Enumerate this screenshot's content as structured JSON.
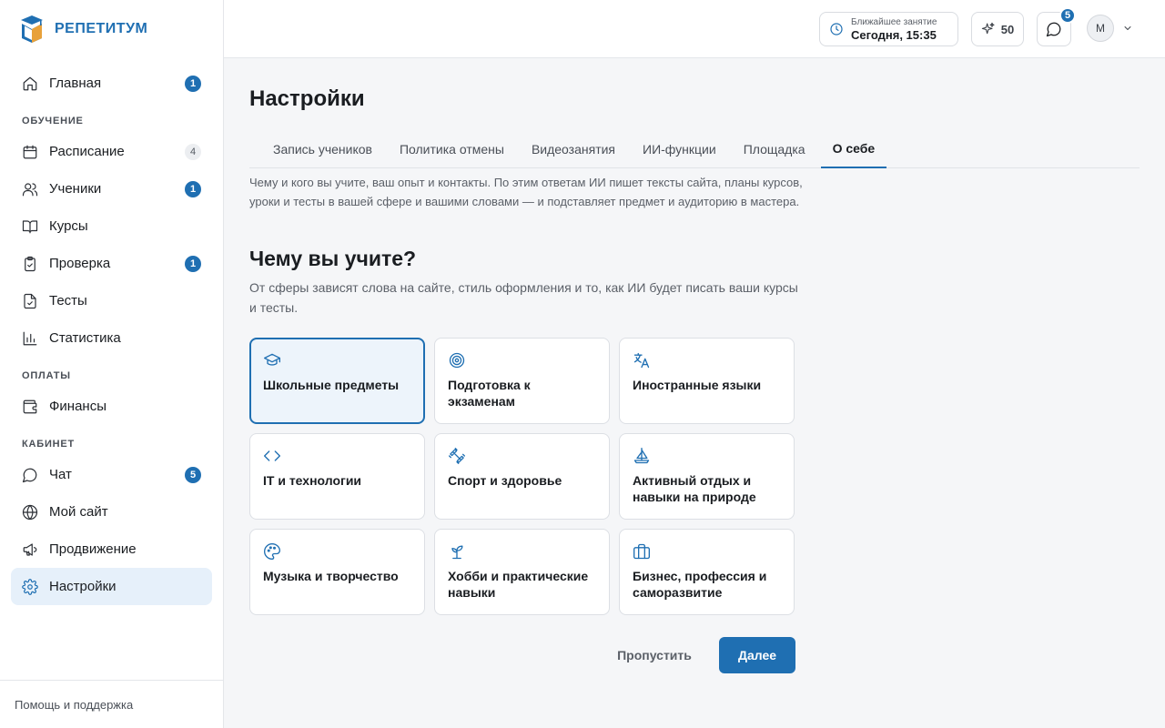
{
  "app": {
    "logo_text": "РЕПЕТИТУМ",
    "accent_color": "#1f6fb2"
  },
  "sidebar": {
    "items": [
      {
        "label": "Главная",
        "icon": "home-icon",
        "badge": "1"
      },
      {
        "section": "ОБУЧЕНИЕ"
      },
      {
        "label": "Расписание",
        "icon": "calendar-icon",
        "badge": "4",
        "badge_style": "muted"
      },
      {
        "label": "Ученики",
        "icon": "users-icon",
        "badge": "1"
      },
      {
        "label": "Курсы",
        "icon": "book-icon"
      },
      {
        "label": "Проверка",
        "icon": "clipboard-check-icon",
        "badge": "1"
      },
      {
        "label": "Тесты",
        "icon": "file-check-icon"
      },
      {
        "label": "Статистика",
        "icon": "bar-chart-icon"
      },
      {
        "section": "ОПЛАТЫ"
      },
      {
        "label": "Финансы",
        "icon": "wallet-icon"
      },
      {
        "section": "КАБИНЕТ"
      },
      {
        "label": "Чат",
        "icon": "message-icon",
        "badge": "5"
      },
      {
        "label": "Мой сайт",
        "icon": "globe-icon"
      },
      {
        "label": "Продвижение",
        "icon": "megaphone-icon"
      },
      {
        "label": "Настройки",
        "icon": "gear-icon",
        "active": true
      }
    ],
    "footer": "Помощь и поддержка"
  },
  "header": {
    "next_lesson_label": "Ближайшее занятие",
    "next_lesson_time": "Сегодня, 15:35",
    "credits": "50",
    "chat_badge": "5",
    "avatar_initial": "М"
  },
  "main": {
    "title": "Настройки",
    "tabs": [
      {
        "label": "Запись учеников"
      },
      {
        "label": "Политика отмены"
      },
      {
        "label": "Видеозанятия"
      },
      {
        "label": "ИИ-функции"
      },
      {
        "label": "Площадка"
      },
      {
        "label": "О себе",
        "active": true
      }
    ],
    "intro": "Чему и кого вы учите, ваш опыт и контакты. По этим ответам ИИ пишет тексты сайта, планы курсов, уроки и тесты в вашей сфере и вашими словами — и подставляет предмет и аудиторию в мастера.",
    "question_title": "Чему вы учите?",
    "question_subtitle": "От сферы зависят слова на сайте, стиль оформления и то, как ИИ будет писать ваши курсы и тесты.",
    "options": [
      {
        "label": "Школьные предметы",
        "icon": "graduation-cap-icon",
        "selected": true
      },
      {
        "label": "Подготовка к экзаменам",
        "icon": "target-icon"
      },
      {
        "label": "Иностранные языки",
        "icon": "translate-icon"
      },
      {
        "label": "IT и технологии",
        "icon": "code-icon"
      },
      {
        "label": "Спорт и здоровье",
        "icon": "dumbbell-icon"
      },
      {
        "label": "Активный отдых и навыки на природе",
        "icon": "sailboat-icon"
      },
      {
        "label": "Музыка и творчество",
        "icon": "palette-icon"
      },
      {
        "label": "Хобби и практические навыки",
        "icon": "sprout-icon"
      },
      {
        "label": "Бизнес, профессия и саморазвитие",
        "icon": "briefcase-icon"
      }
    ],
    "skip_label": "Пропустить",
    "next_label": "Далее"
  }
}
